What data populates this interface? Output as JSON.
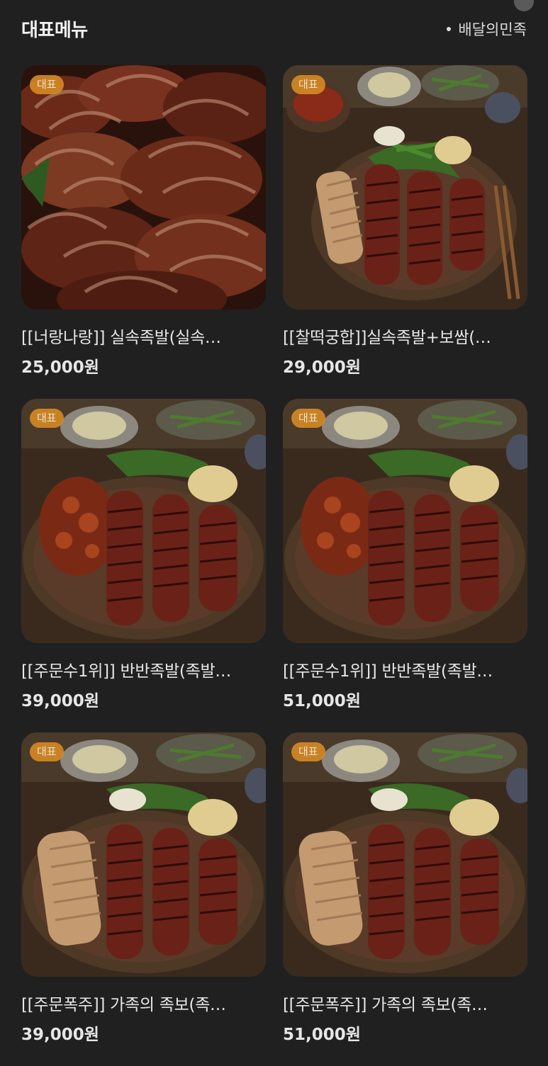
{
  "header": {
    "title": "대표메뉴",
    "source": "배달의민족"
  },
  "menu": [
    {
      "badge": "대표",
      "name": "[[너랑나랑]] 실속족발(실속…",
      "price": "25,000원",
      "photo": "sliced-pork-icon"
    },
    {
      "badge": "대표",
      "name": "[[찰떡궁합]]실속족발+보쌈(…",
      "price": "29,000원",
      "photo": "platter-icon"
    },
    {
      "badge": "대표",
      "name": "[[주문수1위]] 반반족발(족발…",
      "price": "39,000원",
      "photo": "platter-icon"
    },
    {
      "badge": "대표",
      "name": "[[주문수1위]] 반반족발(족발…",
      "price": "51,000원",
      "photo": "platter-icon"
    },
    {
      "badge": "대표",
      "name": "[[주문폭주]] 가족의 족보(족…",
      "price": "39,000원",
      "photo": "platter-icon"
    },
    {
      "badge": "대표",
      "name": "[[주문폭주]] 가족의 족보(족…",
      "price": "51,000원",
      "photo": "platter-icon"
    }
  ],
  "colors": {
    "background": "#202020",
    "badge": "#d68b25",
    "text": "#e6e6e6"
  }
}
